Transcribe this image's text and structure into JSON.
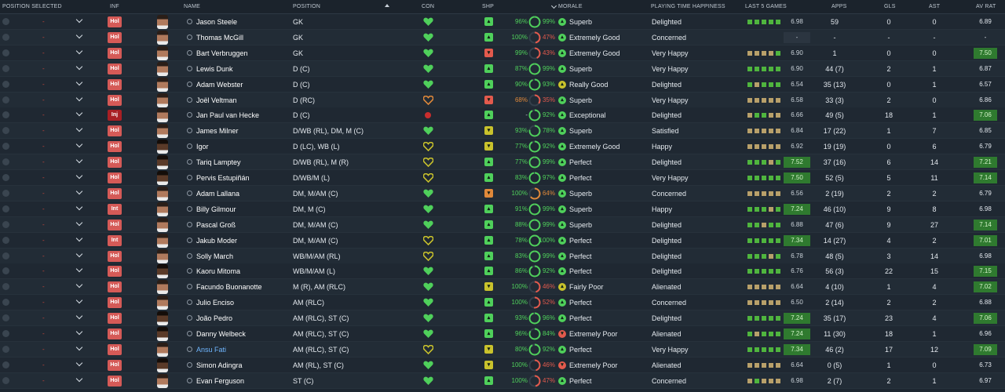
{
  "header": {
    "position_selected": "POSITION SELECTED",
    "inf": "INF",
    "name": "NAME",
    "position": "POSITION",
    "con": "CON",
    "shp": "SHP",
    "morale": "MORALE",
    "playing_time_happiness": "PLAYING TIME HAPPINESS",
    "last_5_games": "LAST 5 GAMES",
    "apps": "APPS",
    "gls": "GLS",
    "ast": "AST",
    "av_rat": "AV RAT"
  },
  "colors": {
    "green": "#4fd05b",
    "yellow": "#c9c22c",
    "orange": "#e0893a",
    "red": "#e35a4d",
    "bar_green": "#4fb53e",
    "bar_tan": "#b8a06a"
  },
  "players": [
    {
      "inf": "Hol",
      "name": "Jason Steele",
      "position": "GK",
      "con": "green",
      "shp": "green",
      "shp_pct": "96%",
      "ring_pct": "99%",
      "ring_val": 0.99,
      "ring_color": "green",
      "morale": "Superb",
      "morale_color": "green",
      "pth": "Delighted",
      "last5": [
        "g",
        "g",
        "g",
        "g",
        "g"
      ],
      "last5_val": "6.98",
      "last5_hi": false,
      "apps": "59",
      "gls": "0",
      "ast": "0",
      "av_rat": "6.89",
      "av_hi": false,
      "dark": false
    },
    {
      "inf": "Hol",
      "name": "Thomas McGill",
      "position": "GK",
      "con": "green",
      "shp": "green",
      "shp_pct": "100%",
      "ring_pct": "47%",
      "ring_val": 0.47,
      "ring_color": "red",
      "morale": "Extremely Good",
      "morale_color": "green",
      "pth": "Concerned",
      "last5": [],
      "last5_val": "-",
      "last5_hi": false,
      "last5_dk": true,
      "apps": "-",
      "gls": "-",
      "ast": "-",
      "av_rat": "-",
      "av_hi": false,
      "dark": false
    },
    {
      "inf": "Hol",
      "name": "Bart Verbruggen",
      "position": "GK",
      "con": "green",
      "shp": "red",
      "shp_pct": "99%",
      "ring_pct": "43%",
      "ring_val": 0.43,
      "ring_color": "red",
      "morale": "Extremely Good",
      "morale_color": "green",
      "pth": "Very Happy",
      "last5": [
        "n",
        "n",
        "n",
        "n",
        "g"
      ],
      "last5_val": "6.90",
      "last5_hi": false,
      "apps": "1",
      "gls": "0",
      "ast": "0",
      "av_rat": "7.50",
      "av_hi": true,
      "dark": false
    },
    {
      "inf": "Hol",
      "name": "Lewis Dunk",
      "position": "D (C)",
      "con": "green",
      "shp": "green",
      "shp_pct": "87%",
      "ring_pct": "99%",
      "ring_val": 0.99,
      "ring_color": "green",
      "morale": "Superb",
      "morale_color": "green",
      "pth": "Very Happy",
      "last5": [
        "g",
        "g",
        "g",
        "g",
        "g"
      ],
      "last5_val": "6.90",
      "last5_hi": false,
      "apps": "44 (7)",
      "gls": "2",
      "ast": "1",
      "av_rat": "6.87",
      "av_hi": false,
      "dark": false
    },
    {
      "inf": "Hol",
      "name": "Adam Webster",
      "position": "D (C)",
      "con": "green",
      "shp": "green",
      "shp_pct": "90%",
      "ring_pct": "93%",
      "ring_val": 0.93,
      "ring_color": "green",
      "morale": "Really Good",
      "morale_color": "yellow",
      "pth": "Delighted",
      "last5": [
        "g",
        "n",
        "g",
        "g",
        "g"
      ],
      "last5_val": "6.54",
      "last5_hi": false,
      "apps": "35 (13)",
      "gls": "0",
      "ast": "1",
      "av_rat": "6.57",
      "av_hi": false,
      "dark": false
    },
    {
      "inf": "Hol",
      "name": "Joël Veltman",
      "position": "D (RC)",
      "con": "orange",
      "shp": "red",
      "shp_pct": "68%",
      "ring_pct": "35%",
      "ring_val": 0.35,
      "ring_color": "red",
      "morale": "Superb",
      "morale_color": "green",
      "pth": "Very Happy",
      "last5": [
        "n",
        "n",
        "n",
        "n",
        "n"
      ],
      "last5_val": "6.58",
      "last5_hi": false,
      "apps": "33 (3)",
      "gls": "2",
      "ast": "0",
      "av_rat": "6.86",
      "av_hi": false,
      "dark": false
    },
    {
      "inf": "Inj",
      "name": "Jan Paul van Hecke",
      "position": "D (C)",
      "con": "injury",
      "shp": "green",
      "shp_pct": "-",
      "ring_pct": "92%",
      "ring_val": 0.92,
      "ring_color": "green",
      "morale": "Exceptional",
      "morale_color": "green",
      "pth": "Delighted",
      "last5": [
        "n",
        "g",
        "g",
        "n",
        "n"
      ],
      "last5_val": "6.66",
      "last5_hi": false,
      "apps": "49 (5)",
      "gls": "18",
      "ast": "1",
      "av_rat": "7.06",
      "av_hi": true,
      "dark": false
    },
    {
      "inf": "Hol",
      "name": "James Milner",
      "position": "D/WB (RL), DM, M (C)",
      "con": "green",
      "shp": "yellow",
      "shp_pct": "93%",
      "ring_pct": "78%",
      "ring_val": 0.78,
      "ring_color": "green",
      "morale": "Superb",
      "morale_color": "green",
      "pth": "Satisfied",
      "last5": [
        "n",
        "n",
        "n",
        "n",
        "n"
      ],
      "last5_val": "6.84",
      "last5_hi": false,
      "apps": "17 (22)",
      "gls": "1",
      "ast": "7",
      "av_rat": "6.85",
      "av_hi": false,
      "dark": false
    },
    {
      "inf": "Hol",
      "name": "Igor",
      "position": "D (LC), WB (L)",
      "con": "yellow",
      "shp": "yellow",
      "shp_pct": "77%",
      "ring_pct": "92%",
      "ring_val": 0.92,
      "ring_color": "green",
      "morale": "Extremely Good",
      "morale_color": "green",
      "pth": "Happy",
      "last5": [
        "n",
        "n",
        "n",
        "n",
        "n"
      ],
      "last5_val": "6.92",
      "last5_hi": false,
      "apps": "19 (19)",
      "gls": "0",
      "ast": "6",
      "av_rat": "6.79",
      "av_hi": false,
      "dark": true
    },
    {
      "inf": "Hol",
      "name": "Tariq Lamptey",
      "position": "D/WB (RL), M (R)",
      "con": "yellow",
      "shp": "green",
      "shp_pct": "77%",
      "ring_pct": "99%",
      "ring_val": 0.99,
      "ring_color": "green",
      "morale": "Perfect",
      "morale_color": "green",
      "pth": "Delighted",
      "last5": [
        "g",
        "g",
        "g",
        "n",
        "g"
      ],
      "last5_val": "7.52",
      "last5_hi": true,
      "apps": "37 (16)",
      "gls": "6",
      "ast": "14",
      "av_rat": "7.21",
      "av_hi": true,
      "dark": true
    },
    {
      "inf": "Hol",
      "name": "Pervis Estupiñán",
      "position": "D/WB/M (L)",
      "con": "yellow",
      "shp": "green",
      "shp_pct": "83%",
      "ring_pct": "97%",
      "ring_val": 0.97,
      "ring_color": "green",
      "morale": "Perfect",
      "morale_color": "green",
      "pth": "Very Happy",
      "last5": [
        "g",
        "g",
        "g",
        "g",
        "g"
      ],
      "last5_val": "7.50",
      "last5_hi": true,
      "apps": "52 (5)",
      "gls": "5",
      "ast": "11",
      "av_rat": "7.14",
      "av_hi": true,
      "dark": true
    },
    {
      "inf": "Hol",
      "name": "Adam Lallana",
      "position": "DM, M/AM (C)",
      "con": "green",
      "shp": "orange",
      "shp_pct": "100%",
      "ring_pct": "64%",
      "ring_val": 0.64,
      "ring_color": "orange",
      "morale": "Superb",
      "morale_color": "green",
      "pth": "Concerned",
      "last5": [
        "n",
        "n",
        "n",
        "n",
        "n"
      ],
      "last5_val": "6.56",
      "last5_hi": false,
      "apps": "2 (19)",
      "gls": "2",
      "ast": "2",
      "av_rat": "6.79",
      "av_hi": false,
      "dark": false
    },
    {
      "inf": "Int",
      "name": "Billy Gilmour",
      "position": "DM, M (C)",
      "con": "green",
      "shp": "green",
      "shp_pct": "91%",
      "ring_pct": "99%",
      "ring_val": 0.99,
      "ring_color": "green",
      "morale": "Superb",
      "morale_color": "green",
      "pth": "Happy",
      "last5": [
        "g",
        "g",
        "g",
        "n",
        "g"
      ],
      "last5_val": "7.24",
      "last5_hi": true,
      "apps": "46 (10)",
      "gls": "9",
      "ast": "8",
      "av_rat": "6.98",
      "av_hi": false,
      "dark": false
    },
    {
      "inf": "Hol",
      "name": "Pascal Groß",
      "position": "DM, M/AM (C)",
      "con": "green",
      "shp": "green",
      "shp_pct": "88%",
      "ring_pct": "99%",
      "ring_val": 0.99,
      "ring_color": "green",
      "morale": "Superb",
      "morale_color": "green",
      "pth": "Delighted",
      "last5": [
        "g",
        "g",
        "n",
        "g",
        "g"
      ],
      "last5_val": "6.88",
      "last5_hi": false,
      "apps": "47 (6)",
      "gls": "9",
      "ast": "27",
      "av_rat": "7.14",
      "av_hi": true,
      "dark": false
    },
    {
      "inf": "Int",
      "name": "Jakub Moder",
      "position": "DM, M/AM (C)",
      "con": "yellow",
      "shp": "green",
      "shp_pct": "78%",
      "ring_pct": "100%",
      "ring_val": 1.0,
      "ring_color": "green",
      "morale": "Perfect",
      "morale_color": "green",
      "pth": "Delighted",
      "last5": [
        "g",
        "g",
        "g",
        "g",
        "g"
      ],
      "last5_val": "7.34",
      "last5_hi": true,
      "apps": "14 (27)",
      "gls": "4",
      "ast": "2",
      "av_rat": "7.01",
      "av_hi": true,
      "dark": false
    },
    {
      "inf": "Hol",
      "name": "Solly March",
      "position": "WB/M/AM (RL)",
      "con": "yellow",
      "shp": "green",
      "shp_pct": "83%",
      "ring_pct": "99%",
      "ring_val": 0.99,
      "ring_color": "green",
      "morale": "Perfect",
      "morale_color": "green",
      "pth": "Delighted",
      "last5": [
        "g",
        "g",
        "g",
        "n",
        "g"
      ],
      "last5_val": "6.78",
      "last5_hi": false,
      "apps": "48 (5)",
      "gls": "3",
      "ast": "14",
      "av_rat": "6.98",
      "av_hi": false,
      "dark": false
    },
    {
      "inf": "Hol",
      "name": "Kaoru Mitoma",
      "position": "WB/M/AM (L)",
      "con": "green",
      "shp": "green",
      "shp_pct": "86%",
      "ring_pct": "92%",
      "ring_val": 0.92,
      "ring_color": "green",
      "morale": "Perfect",
      "morale_color": "green",
      "pth": "Delighted",
      "last5": [
        "g",
        "g",
        "g",
        "g",
        "g"
      ],
      "last5_val": "6.76",
      "last5_hi": false,
      "apps": "56 (3)",
      "gls": "22",
      "ast": "15",
      "av_rat": "7.15",
      "av_hi": true,
      "dark": true
    },
    {
      "inf": "Hol",
      "name": "Facundo Buonanotte",
      "position": "M (R), AM (RLC)",
      "con": "green",
      "shp": "yellow",
      "shp_pct": "100%",
      "ring_pct": "46%",
      "ring_val": 0.46,
      "ring_color": "red",
      "morale": "Fairly Poor",
      "morale_color": "yellow",
      "pth": "Alienated",
      "last5": [
        "n",
        "n",
        "n",
        "n",
        "n"
      ],
      "last5_val": "6.64",
      "last5_hi": false,
      "apps": "4 (10)",
      "gls": "1",
      "ast": "4",
      "av_rat": "7.02",
      "av_hi": true,
      "dark": false
    },
    {
      "inf": "Hol",
      "name": "Julio Enciso",
      "position": "AM (RLC)",
      "con": "green",
      "shp": "green",
      "shp_pct": "100%",
      "ring_pct": "52%",
      "ring_val": 0.52,
      "ring_color": "red",
      "morale": "Perfect",
      "morale_color": "green",
      "pth": "Concerned",
      "last5": [
        "n",
        "n",
        "n",
        "n",
        "n"
      ],
      "last5_val": "6.50",
      "last5_hi": false,
      "apps": "2 (14)",
      "gls": "2",
      "ast": "2",
      "av_rat": "6.88",
      "av_hi": false,
      "dark": false
    },
    {
      "inf": "Hol",
      "name": "João Pedro",
      "position": "AM (RLC), ST (C)",
      "con": "green",
      "shp": "green",
      "shp_pct": "93%",
      "ring_pct": "96%",
      "ring_val": 0.96,
      "ring_color": "green",
      "morale": "Perfect",
      "morale_color": "green",
      "pth": "Delighted",
      "last5": [
        "g",
        "g",
        "g",
        "g",
        "g"
      ],
      "last5_val": "7.24",
      "last5_hi": true,
      "apps": "35 (17)",
      "gls": "23",
      "ast": "4",
      "av_rat": "7.06",
      "av_hi": true,
      "dark": true
    },
    {
      "inf": "Hol",
      "name": "Danny Welbeck",
      "position": "AM (RLC), ST (C)",
      "con": "green",
      "shp": "green",
      "shp_pct": "96%",
      "ring_pct": "84%",
      "ring_val": 0.84,
      "ring_color": "green",
      "morale": "Extremely Poor",
      "morale_color": "red",
      "pth": "Alienated",
      "last5": [
        "g",
        "n",
        "g",
        "g",
        "g"
      ],
      "last5_val": "7.24",
      "last5_hi": true,
      "apps": "11 (30)",
      "gls": "18",
      "ast": "1",
      "av_rat": "6.96",
      "av_hi": false,
      "dark": true
    },
    {
      "inf": "Hol",
      "name": "Ansu Fati",
      "position": "AM (RLC), ST (C)",
      "con": "yellow",
      "shp": "yellow",
      "shp_pct": "80%",
      "ring_pct": "92%",
      "ring_val": 0.92,
      "ring_color": "green",
      "morale": "Perfect",
      "morale_color": "green",
      "pth": "Very Happy",
      "last5": [
        "g",
        "g",
        "g",
        "g",
        "g"
      ],
      "last5_val": "7.34",
      "last5_hi": true,
      "apps": "46 (2)",
      "gls": "17",
      "ast": "12",
      "av_rat": "7.09",
      "av_hi": true,
      "dark": false,
      "link": true
    },
    {
      "inf": "Hol",
      "name": "Simon Adingra",
      "position": "AM (RL), ST (C)",
      "con": "green",
      "shp": "yellow",
      "shp_pct": "100%",
      "ring_pct": "46%",
      "ring_val": 0.46,
      "ring_color": "red",
      "morale": "Extremely Poor",
      "morale_color": "red",
      "pth": "Alienated",
      "last5": [
        "n",
        "n",
        "n",
        "n",
        "n"
      ],
      "last5_val": "6.64",
      "last5_hi": false,
      "apps": "0 (5)",
      "gls": "1",
      "ast": "0",
      "av_rat": "6.73",
      "av_hi": false,
      "dark": true
    },
    {
      "inf": "Hol",
      "name": "Evan Ferguson",
      "position": "ST (C)",
      "con": "green",
      "shp": "green",
      "shp_pct": "100%",
      "ring_pct": "47%",
      "ring_val": 0.47,
      "ring_color": "red",
      "morale": "Perfect",
      "morale_color": "green",
      "pth": "Concerned",
      "last5": [
        "n",
        "g",
        "n",
        "n",
        "n"
      ],
      "last5_val": "6.98",
      "last5_hi": false,
      "apps": "2 (7)",
      "gls": "2",
      "ast": "1",
      "av_rat": "6.97",
      "av_hi": false,
      "dark": false
    }
  ]
}
